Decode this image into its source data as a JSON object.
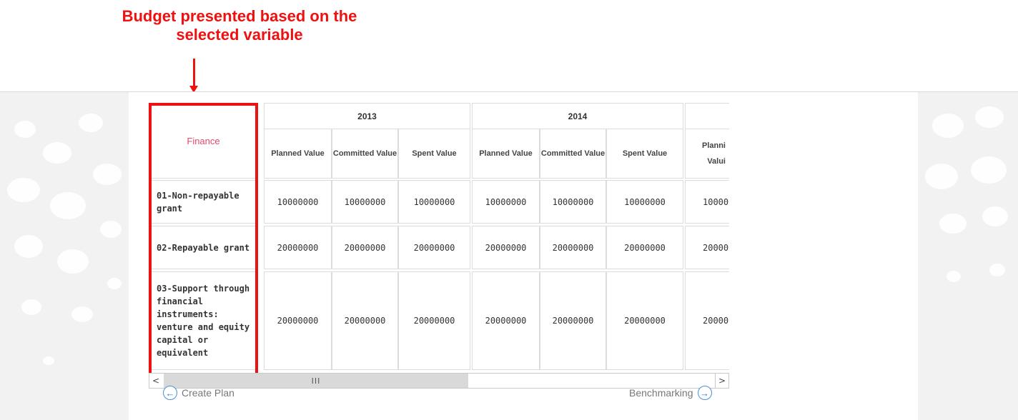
{
  "annotation": {
    "line1": "Budget presented based on the",
    "line2": "selected variable"
  },
  "table": {
    "corner_label": "Finance",
    "years": [
      "2013",
      "2014",
      ""
    ],
    "sub_headers": [
      "Planned Value",
      "Committed Value",
      "Spent Value"
    ],
    "third_year_partial_header": "Planni Valui",
    "rows": [
      {
        "label": "01-Non-repayable grant",
        "values": [
          "10000000",
          "10000000",
          "10000000",
          "10000000",
          "10000000",
          "10000000",
          "10000("
        ]
      },
      {
        "label": "02-Repayable grant",
        "values": [
          "20000000",
          "20000000",
          "20000000",
          "20000000",
          "20000000",
          "20000000",
          "20000("
        ]
      },
      {
        "label": "03-Support through financial instruments: venture and equity capital or equivalent",
        "values": [
          "20000000",
          "20000000",
          "20000000",
          "20000000",
          "20000000",
          "20000000",
          "20000("
        ]
      }
    ]
  },
  "scrollbar": {
    "thumb": "III",
    "left_arrow": "<",
    "right_arrow": ">"
  },
  "nav": {
    "prev": "Create Plan",
    "next": "Benchmarking"
  },
  "colors": {
    "highlight": "#ee1111",
    "finance": "#e34a6b",
    "nav_icon": "#2e7ad6"
  }
}
